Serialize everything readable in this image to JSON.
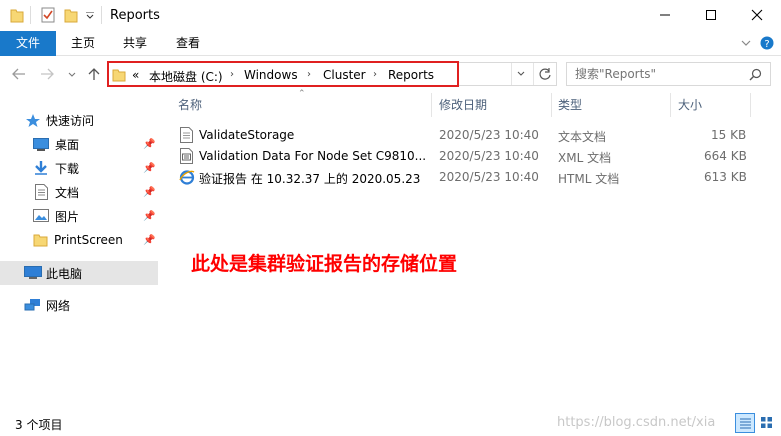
{
  "titlebar": {
    "title": "Reports",
    "minimize_icon": "minimize-icon",
    "maximize_icon": "maximize-icon",
    "close_icon": "close-icon"
  },
  "ribbon": {
    "tabs": [
      "文件",
      "主页",
      "共享",
      "查看"
    ],
    "accent": "#1979ca"
  },
  "address": {
    "breadcrumbs": [
      "«",
      "本地磁盘 (C:)",
      "Windows",
      "Cluster",
      "Reports"
    ],
    "highlight_color": "#e02020"
  },
  "search": {
    "placeholder": "搜索\"Reports\""
  },
  "sidebar": {
    "items": [
      {
        "label": "快速访问",
        "icon": "star-icon"
      },
      {
        "label": "桌面",
        "icon": "desktop-icon",
        "pinned": true
      },
      {
        "label": "下载",
        "icon": "download-icon",
        "pinned": true
      },
      {
        "label": "文档",
        "icon": "document-icon",
        "pinned": true
      },
      {
        "label": "图片",
        "icon": "pictures-icon",
        "pinned": true
      },
      {
        "label": "PrintScreen",
        "icon": "folder-icon",
        "pinned": true
      },
      {
        "label": "此电脑",
        "icon": "computer-icon"
      },
      {
        "label": "网络",
        "icon": "network-icon"
      }
    ]
  },
  "columns": [
    "名称",
    "修改日期",
    "类型",
    "大小"
  ],
  "files": [
    {
      "name": "ValidateStorage",
      "date": "2020/5/23 10:40",
      "type": "文本文档",
      "size": "15 KB",
      "icon": "text-file-icon"
    },
    {
      "name": "Validation Data For Node Set C9810...",
      "date": "2020/5/23 10:40",
      "type": "XML 文档",
      "size": "664 KB",
      "icon": "xml-file-icon"
    },
    {
      "name": "验证报告 在 10.32.37 上的 2020.05.23",
      "date": "2020/5/23 10:40",
      "type": "HTML 文档",
      "size": "613 KB",
      "icon": "ie-html-icon"
    }
  ],
  "annotation": "此处是集群验证报告的存储位置",
  "status": {
    "count": "3 个项目",
    "watermark": "https://blog.csdn.net/xia"
  }
}
